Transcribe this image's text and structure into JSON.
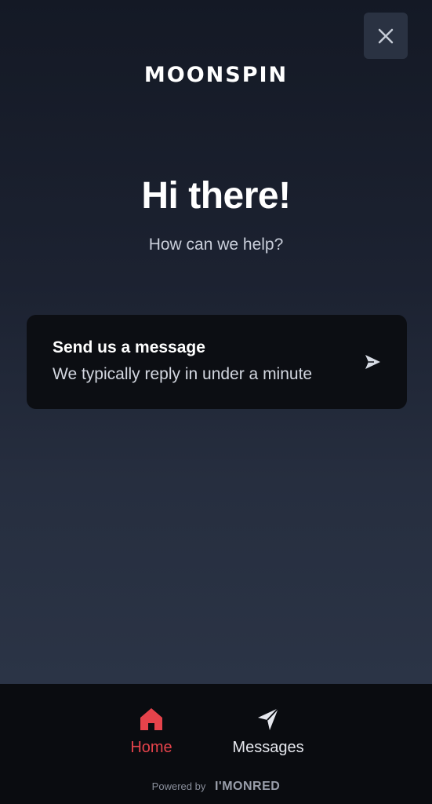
{
  "header": {
    "logo_text": "MOONSPIN",
    "close_icon": "close-icon"
  },
  "main": {
    "greeting": "Hi there!",
    "subtitle": "How can we help?"
  },
  "message_card": {
    "title": "Send us a message",
    "subtitle": "We typically reply in under a minute",
    "icon": "send-icon"
  },
  "bottom_nav": {
    "items": [
      {
        "label": "Home",
        "icon": "home-icon",
        "active": true
      },
      {
        "label": "Messages",
        "icon": "send-icon",
        "active": false
      }
    ]
  },
  "footer": {
    "powered_by": "Powered by",
    "brand": "I'MONRED"
  },
  "colors": {
    "accent": "#e5434b",
    "card_bg": "#0c0e13",
    "bottom_bar_bg": "#0a0c10",
    "close_button_bg": "#2a3242"
  }
}
